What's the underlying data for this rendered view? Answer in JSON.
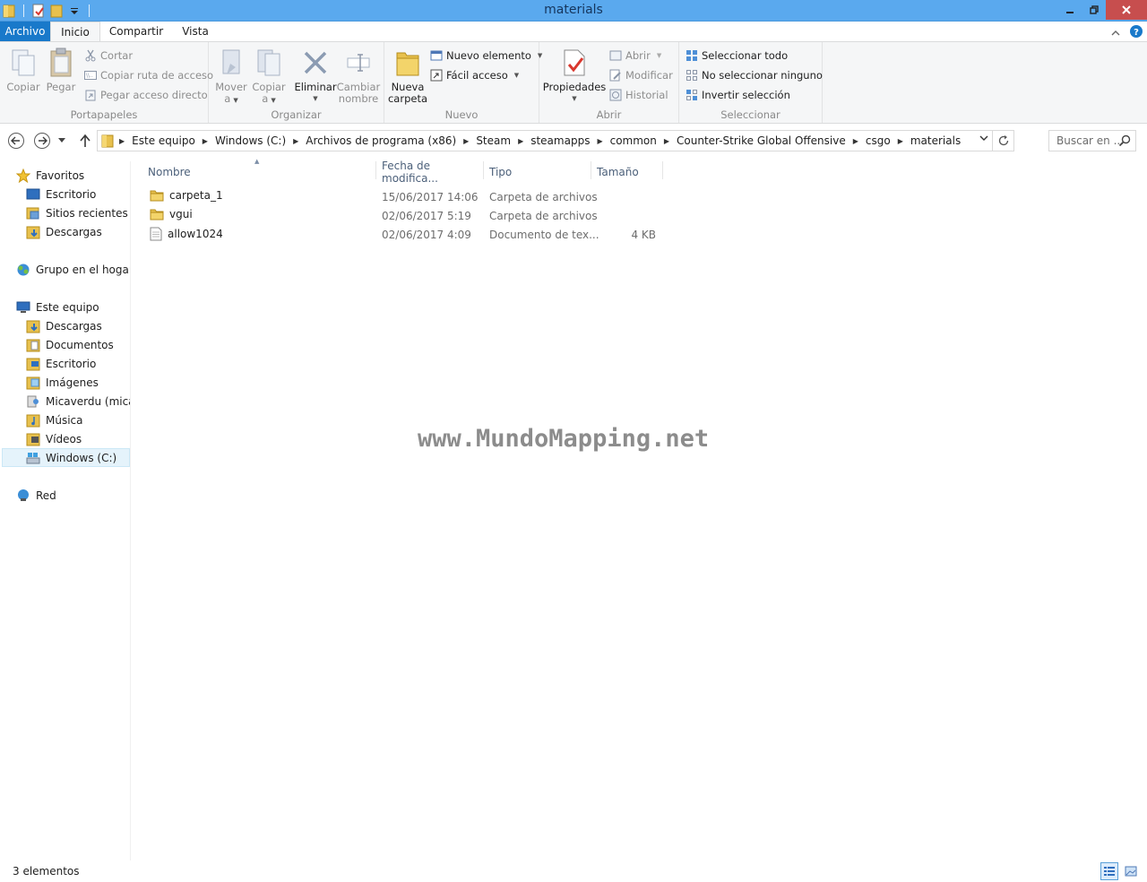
{
  "window": {
    "title": "materials"
  },
  "ribbon_tabs": {
    "file": "Archivo",
    "home": "Inicio",
    "share": "Compartir",
    "view": "Vista"
  },
  "ribbon": {
    "clipboard": {
      "label": "Portapapeles",
      "copy": "Copiar",
      "paste": "Pegar",
      "cut": "Cortar",
      "copy_path": "Copiar ruta de acceso",
      "paste_shortcut": "Pegar acceso directo"
    },
    "organize": {
      "label": "Organizar",
      "move_1": "Mover",
      "move_2": "a",
      "copy_to_1": "Copiar",
      "copy_to_2": "a",
      "delete": "Eliminar",
      "rename_1": "Cambiar",
      "rename_2": "nombre"
    },
    "new": {
      "label": "Nuevo",
      "new_folder_1": "Nueva",
      "new_folder_2": "carpeta",
      "new_item": "Nuevo elemento",
      "easy_access": "Fácil acceso"
    },
    "open": {
      "label": "Abrir",
      "properties": "Propiedades",
      "open": "Abrir",
      "edit": "Modificar",
      "history": "Historial"
    },
    "select": {
      "label": "Seleccionar",
      "select_all": "Seleccionar todo",
      "select_none": "No seleccionar ninguno",
      "invert": "Invertir selección"
    }
  },
  "address": {
    "crumbs": [
      "Este equipo",
      "Windows (C:)",
      "Archivos de programa (x86)",
      "Steam",
      "steamapps",
      "common",
      "Counter-Strike Global Offensive",
      "csgo",
      "materials"
    ],
    "search_placeholder": "Buscar en ..."
  },
  "nav": {
    "favorites": "Favoritos",
    "fav_items": [
      "Escritorio",
      "Sitios recientes",
      "Descargas"
    ],
    "homegroup": "Grupo en el hogar",
    "this_pc": "Este equipo",
    "pc_items": [
      "Descargas",
      "Documentos",
      "Escritorio",
      "Imágenes",
      "Micaverdu (micae",
      "Música",
      "Vídeos",
      "Windows (C:)"
    ],
    "network": "Red"
  },
  "columns": {
    "name": "Nombre",
    "date": "Fecha de modifica...",
    "type": "Tipo",
    "size": "Tamaño"
  },
  "files": [
    {
      "name": "carpeta_1",
      "date": "15/06/2017 14:06",
      "type": "Carpeta de archivos",
      "size": "",
      "icon": "folder-icon"
    },
    {
      "name": "vgui",
      "date": "02/06/2017 5:19",
      "type": "Carpeta de archivos",
      "size": "",
      "icon": "folder-icon"
    },
    {
      "name": "allow1024",
      "date": "02/06/2017 4:09",
      "type": "Documento de tex...",
      "size": "4 KB",
      "icon": "text-file-icon"
    }
  ],
  "watermark": "www.MundoMapping.net",
  "status": {
    "count": "3 elementos"
  },
  "colors": {
    "titlebar": "#5aa9ee",
    "file_tab": "#1979ca",
    "close_button": "#c74e4e",
    "folder": "#e8c14e"
  }
}
